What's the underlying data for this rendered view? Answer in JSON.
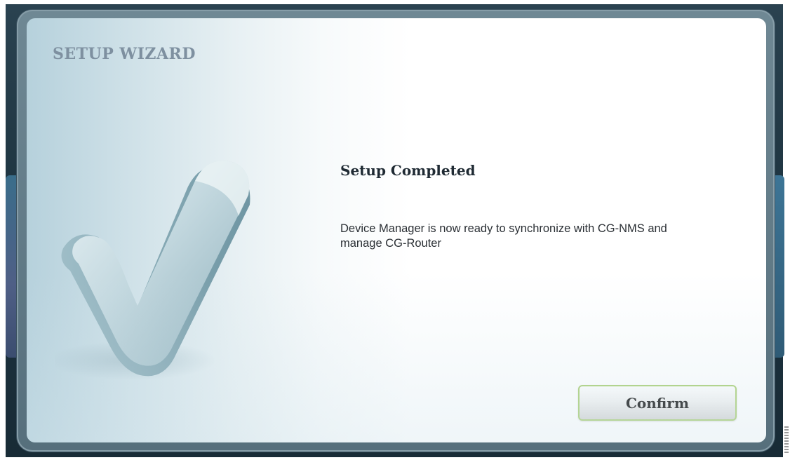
{
  "wizard": {
    "title": "SETUP WIZARD",
    "icon": "checkmark-icon"
  },
  "content": {
    "heading": "Setup Completed",
    "message": "Device Manager is now ready to synchronize with CG-NMS and manage CG-Router"
  },
  "actions": {
    "confirm_label": "Confirm"
  },
  "colors": {
    "title_text": "#7e90a0",
    "button_border": "#a9cf73",
    "frame": "#566f7c"
  }
}
